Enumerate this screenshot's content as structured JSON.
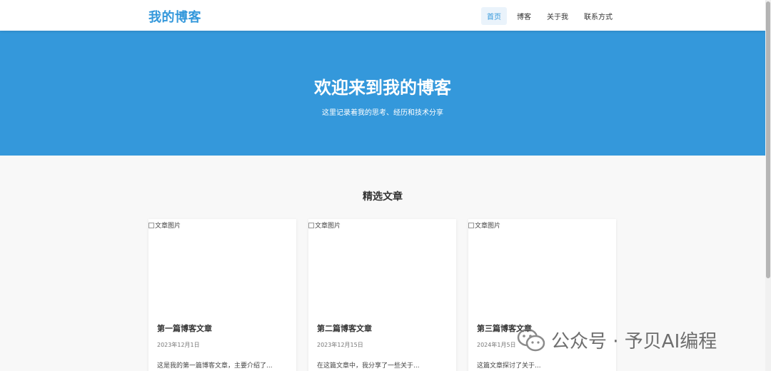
{
  "brand": "我的博客",
  "nav": [
    "首页",
    "博客",
    "关于我",
    "联系方式"
  ],
  "hero": {
    "title": "欢迎来到我的博客",
    "subtitle": "这里记录着我的思考、经历和技术分享"
  },
  "featured": {
    "title": "精选文章",
    "cards": [
      {
        "img_alt": "文章图片",
        "title": "第一篇博客文章",
        "date": "2023年12月1日",
        "excerpt": "这是我的第一篇博客文章，主要介绍了..."
      },
      {
        "img_alt": "文章图片",
        "title": "第二篇博客文章",
        "date": "2023年12月15日",
        "excerpt": "在这篇文章中，我分享了一些关于..."
      },
      {
        "img_alt": "文章图片",
        "title": "第三篇博客文章",
        "date": "2024年1月5日",
        "excerpt": "这篇文章探讨了关于..."
      }
    ]
  },
  "watermark": "公众号 · 予贝AI编程",
  "colors": {
    "accent": "#3498db",
    "page_bg": "#f8f8f8"
  }
}
